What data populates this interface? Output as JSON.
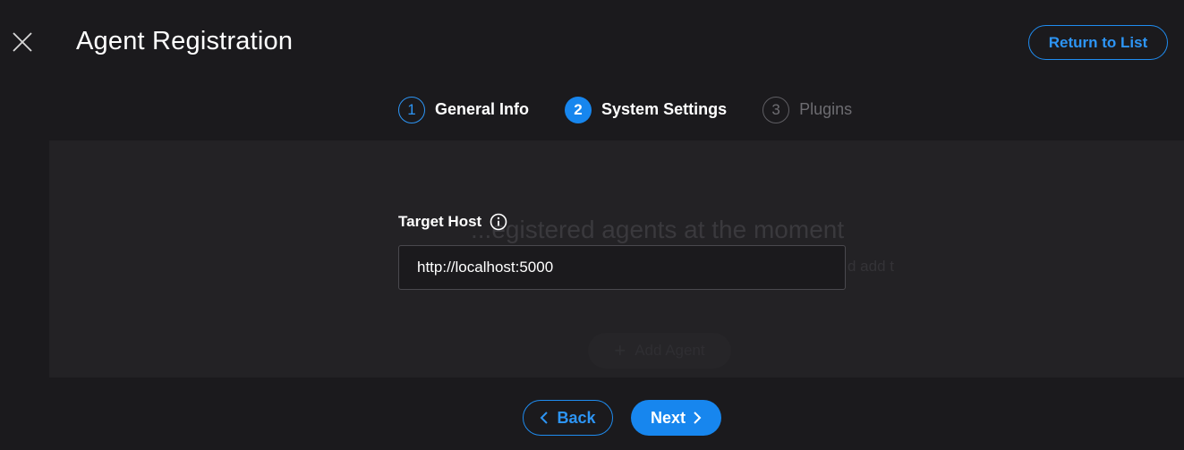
{
  "header": {
    "title": "Agent Registration",
    "return_label": "Return to List",
    "close_icon": "close-icon"
  },
  "stepper": {
    "steps": [
      {
        "number": "1",
        "label": "General Info",
        "state": "done"
      },
      {
        "number": "2",
        "label": "System Settings",
        "state": "active"
      },
      {
        "number": "3",
        "label": "Plugins",
        "state": "pending"
      }
    ]
  },
  "background_page": {
    "empty_title": "...egistered agents at the moment",
    "empty_subtitle": "d add t",
    "add_agent_label": "Add Agent"
  },
  "form": {
    "target_host_label": "Target Host",
    "target_host_value": "http://localhost:5000",
    "info_icon": "info-icon"
  },
  "footer": {
    "back_label": "Back",
    "next_label": "Next"
  },
  "colors": {
    "accent": "#1786ee",
    "background": "#1b1a1d",
    "panel": "#232225"
  }
}
